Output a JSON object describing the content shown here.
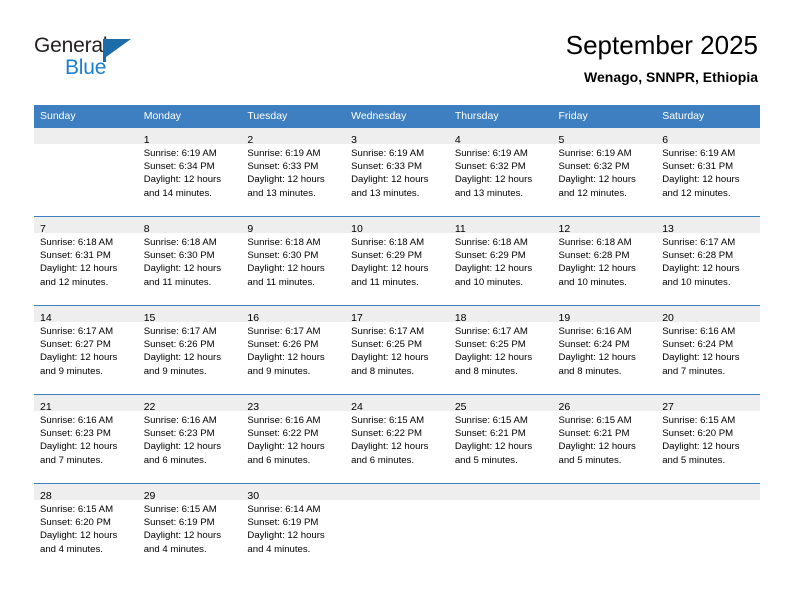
{
  "brand": {
    "name_part1": "General",
    "name_part2": "Blue",
    "primary_color": "#1b7fd4",
    "header_color": "#3d7fc1"
  },
  "header": {
    "title": "September 2025",
    "subtitle": "Wenago, SNNPR, Ethiopia"
  },
  "calendar": {
    "weekday_headers": [
      "Sunday",
      "Monday",
      "Tuesday",
      "Wednesday",
      "Thursday",
      "Friday",
      "Saturday"
    ],
    "weeks": [
      [
        {
          "day": "",
          "sunrise": "",
          "sunset": "",
          "daylight1": "",
          "daylight2": ""
        },
        {
          "day": "1",
          "sunrise": "Sunrise: 6:19 AM",
          "sunset": "Sunset: 6:34 PM",
          "daylight1": "Daylight: 12 hours",
          "daylight2": "and 14 minutes."
        },
        {
          "day": "2",
          "sunrise": "Sunrise: 6:19 AM",
          "sunset": "Sunset: 6:33 PM",
          "daylight1": "Daylight: 12 hours",
          "daylight2": "and 13 minutes."
        },
        {
          "day": "3",
          "sunrise": "Sunrise: 6:19 AM",
          "sunset": "Sunset: 6:33 PM",
          "daylight1": "Daylight: 12 hours",
          "daylight2": "and 13 minutes."
        },
        {
          "day": "4",
          "sunrise": "Sunrise: 6:19 AM",
          "sunset": "Sunset: 6:32 PM",
          "daylight1": "Daylight: 12 hours",
          "daylight2": "and 13 minutes."
        },
        {
          "day": "5",
          "sunrise": "Sunrise: 6:19 AM",
          "sunset": "Sunset: 6:32 PM",
          "daylight1": "Daylight: 12 hours",
          "daylight2": "and 12 minutes."
        },
        {
          "day": "6",
          "sunrise": "Sunrise: 6:19 AM",
          "sunset": "Sunset: 6:31 PM",
          "daylight1": "Daylight: 12 hours",
          "daylight2": "and 12 minutes."
        }
      ],
      [
        {
          "day": "7",
          "sunrise": "Sunrise: 6:18 AM",
          "sunset": "Sunset: 6:31 PM",
          "daylight1": "Daylight: 12 hours",
          "daylight2": "and 12 minutes."
        },
        {
          "day": "8",
          "sunrise": "Sunrise: 6:18 AM",
          "sunset": "Sunset: 6:30 PM",
          "daylight1": "Daylight: 12 hours",
          "daylight2": "and 11 minutes."
        },
        {
          "day": "9",
          "sunrise": "Sunrise: 6:18 AM",
          "sunset": "Sunset: 6:30 PM",
          "daylight1": "Daylight: 12 hours",
          "daylight2": "and 11 minutes."
        },
        {
          "day": "10",
          "sunrise": "Sunrise: 6:18 AM",
          "sunset": "Sunset: 6:29 PM",
          "daylight1": "Daylight: 12 hours",
          "daylight2": "and 11 minutes."
        },
        {
          "day": "11",
          "sunrise": "Sunrise: 6:18 AM",
          "sunset": "Sunset: 6:29 PM",
          "daylight1": "Daylight: 12 hours",
          "daylight2": "and 10 minutes."
        },
        {
          "day": "12",
          "sunrise": "Sunrise: 6:18 AM",
          "sunset": "Sunset: 6:28 PM",
          "daylight1": "Daylight: 12 hours",
          "daylight2": "and 10 minutes."
        },
        {
          "day": "13",
          "sunrise": "Sunrise: 6:17 AM",
          "sunset": "Sunset: 6:28 PM",
          "daylight1": "Daylight: 12 hours",
          "daylight2": "and 10 minutes."
        }
      ],
      [
        {
          "day": "14",
          "sunrise": "Sunrise: 6:17 AM",
          "sunset": "Sunset: 6:27 PM",
          "daylight1": "Daylight: 12 hours",
          "daylight2": "and 9 minutes."
        },
        {
          "day": "15",
          "sunrise": "Sunrise: 6:17 AM",
          "sunset": "Sunset: 6:26 PM",
          "daylight1": "Daylight: 12 hours",
          "daylight2": "and 9 minutes."
        },
        {
          "day": "16",
          "sunrise": "Sunrise: 6:17 AM",
          "sunset": "Sunset: 6:26 PM",
          "daylight1": "Daylight: 12 hours",
          "daylight2": "and 9 minutes."
        },
        {
          "day": "17",
          "sunrise": "Sunrise: 6:17 AM",
          "sunset": "Sunset: 6:25 PM",
          "daylight1": "Daylight: 12 hours",
          "daylight2": "and 8 minutes."
        },
        {
          "day": "18",
          "sunrise": "Sunrise: 6:17 AM",
          "sunset": "Sunset: 6:25 PM",
          "daylight1": "Daylight: 12 hours",
          "daylight2": "and 8 minutes."
        },
        {
          "day": "19",
          "sunrise": "Sunrise: 6:16 AM",
          "sunset": "Sunset: 6:24 PM",
          "daylight1": "Daylight: 12 hours",
          "daylight2": "and 8 minutes."
        },
        {
          "day": "20",
          "sunrise": "Sunrise: 6:16 AM",
          "sunset": "Sunset: 6:24 PM",
          "daylight1": "Daylight: 12 hours",
          "daylight2": "and 7 minutes."
        }
      ],
      [
        {
          "day": "21",
          "sunrise": "Sunrise: 6:16 AM",
          "sunset": "Sunset: 6:23 PM",
          "daylight1": "Daylight: 12 hours",
          "daylight2": "and 7 minutes."
        },
        {
          "day": "22",
          "sunrise": "Sunrise: 6:16 AM",
          "sunset": "Sunset: 6:23 PM",
          "daylight1": "Daylight: 12 hours",
          "daylight2": "and 6 minutes."
        },
        {
          "day": "23",
          "sunrise": "Sunrise: 6:16 AM",
          "sunset": "Sunset: 6:22 PM",
          "daylight1": "Daylight: 12 hours",
          "daylight2": "and 6 minutes."
        },
        {
          "day": "24",
          "sunrise": "Sunrise: 6:15 AM",
          "sunset": "Sunset: 6:22 PM",
          "daylight1": "Daylight: 12 hours",
          "daylight2": "and 6 minutes."
        },
        {
          "day": "25",
          "sunrise": "Sunrise: 6:15 AM",
          "sunset": "Sunset: 6:21 PM",
          "daylight1": "Daylight: 12 hours",
          "daylight2": "and 5 minutes."
        },
        {
          "day": "26",
          "sunrise": "Sunrise: 6:15 AM",
          "sunset": "Sunset: 6:21 PM",
          "daylight1": "Daylight: 12 hours",
          "daylight2": "and 5 minutes."
        },
        {
          "day": "27",
          "sunrise": "Sunrise: 6:15 AM",
          "sunset": "Sunset: 6:20 PM",
          "daylight1": "Daylight: 12 hours",
          "daylight2": "and 5 minutes."
        }
      ],
      [
        {
          "day": "28",
          "sunrise": "Sunrise: 6:15 AM",
          "sunset": "Sunset: 6:20 PM",
          "daylight1": "Daylight: 12 hours",
          "daylight2": "and 4 minutes."
        },
        {
          "day": "29",
          "sunrise": "Sunrise: 6:15 AM",
          "sunset": "Sunset: 6:19 PM",
          "daylight1": "Daylight: 12 hours",
          "daylight2": "and 4 minutes."
        },
        {
          "day": "30",
          "sunrise": "Sunrise: 6:14 AM",
          "sunset": "Sunset: 6:19 PM",
          "daylight1": "Daylight: 12 hours",
          "daylight2": "and 4 minutes."
        },
        {
          "day": "",
          "sunrise": "",
          "sunset": "",
          "daylight1": "",
          "daylight2": ""
        },
        {
          "day": "",
          "sunrise": "",
          "sunset": "",
          "daylight1": "",
          "daylight2": ""
        },
        {
          "day": "",
          "sunrise": "",
          "sunset": "",
          "daylight1": "",
          "daylight2": ""
        },
        {
          "day": "",
          "sunrise": "",
          "sunset": "",
          "daylight1": "",
          "daylight2": ""
        }
      ]
    ]
  }
}
